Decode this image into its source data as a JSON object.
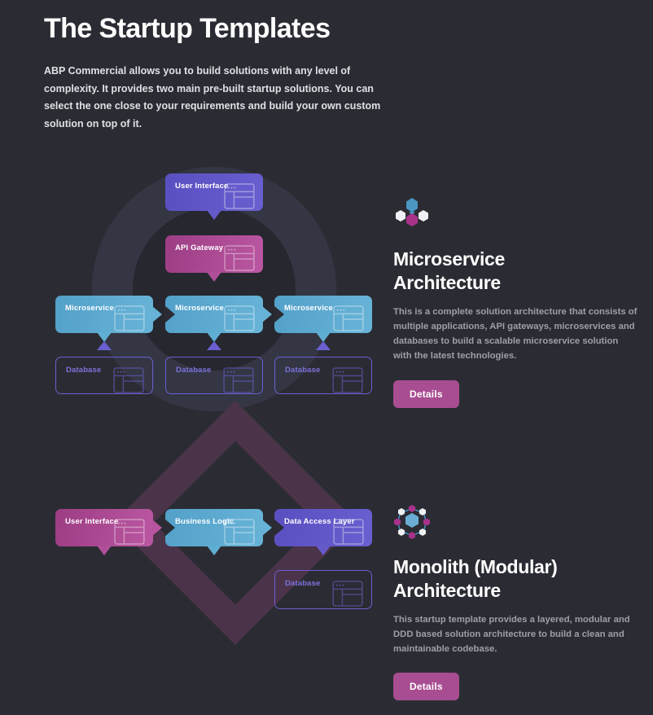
{
  "header": {
    "title": "The Startup Templates",
    "description": "ABP Commercial allows you to build solutions with any level of complexity. It provides two main pre-built startup solutions. You can select the one close to your requirements and build your own custom solution on top of it."
  },
  "colors": {
    "background": "#2b2c33",
    "purple": "#6a5fd0",
    "pink": "#b0509a",
    "blue": "#5faed3",
    "outline_purple": "#6a5fd0",
    "text_muted": "#9d9eaa",
    "circle_outer": "#343644",
    "circle_inner": "#26272f",
    "diamond": "#4b3449",
    "details_button": "#a84d91"
  },
  "sections": [
    {
      "id": "microservice",
      "icon_name": "microservice-hexagons-icon",
      "title": "Microservice Architecture",
      "title_line1": "Microservice",
      "title_line2": "Architecture",
      "description": "This is a complete solution architecture that consists of multiple applications, API gateways, microservices and databases to build a scalable microservice solution with the latest technologies.",
      "button_label": "Details",
      "diagram": {
        "nodes": [
          {
            "label": "User Interface",
            "style": "purple",
            "kind": "bubble"
          },
          {
            "label": "API Gateway",
            "style": "pink",
            "kind": "bubble"
          },
          {
            "label": "Microservice",
            "style": "blue",
            "kind": "bubble"
          },
          {
            "label": "Microservice",
            "style": "blue",
            "kind": "bubble"
          },
          {
            "label": "Microservice",
            "style": "blue",
            "kind": "bubble"
          },
          {
            "label": "Database",
            "style": "outline",
            "kind": "plain"
          },
          {
            "label": "Database",
            "style": "outline",
            "kind": "plain"
          },
          {
            "label": "Database",
            "style": "outline",
            "kind": "plain"
          }
        ]
      }
    },
    {
      "id": "monolith",
      "icon_name": "monolith-hexagon-ring-icon",
      "title": "Monolith (Modular) Architecture",
      "title_line1": "Monolith (Modular)",
      "title_line2": "Architecture",
      "description": "This startup template provides a layered, modular and DDD based solution architecture to build a clean and maintainable codebase.",
      "button_label": "Details",
      "diagram": {
        "nodes": [
          {
            "label": "User Interface",
            "style": "pink",
            "kind": "bubble"
          },
          {
            "label": "Business Logic",
            "style": "blue",
            "kind": "bubble"
          },
          {
            "label": "Data Access Layer",
            "style": "purple",
            "kind": "bubble"
          },
          {
            "label": "Database",
            "style": "outline",
            "kind": "plain"
          }
        ]
      }
    }
  ],
  "icons": {
    "card_icon_name": "window-wireframe-icon"
  }
}
